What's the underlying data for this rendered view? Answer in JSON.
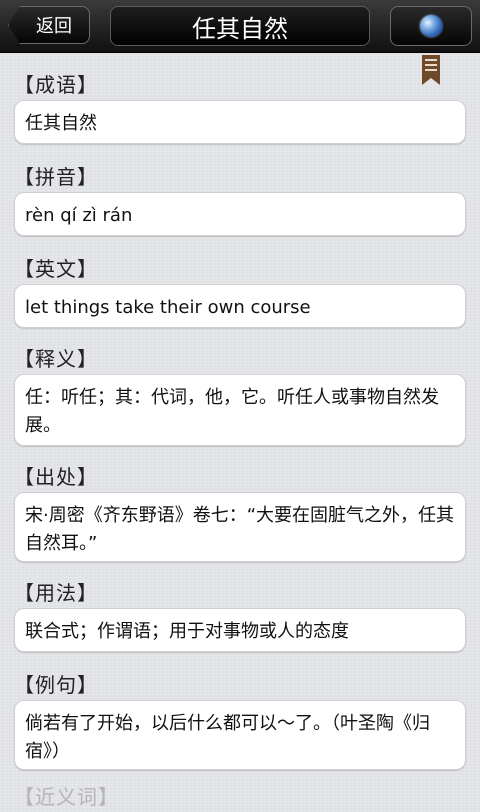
{
  "header": {
    "back_label": "返回",
    "title": "任其自然",
    "globe_icon": "globe-icon"
  },
  "bookmark_icon": "bookmark-icon",
  "sections": [
    {
      "label": "【成语】",
      "value": "任其自然"
    },
    {
      "label": "【拼音】",
      "value": "rèn qí zì rán"
    },
    {
      "label": "【英文】",
      "value": "let things take their own course"
    },
    {
      "label": "【释义】",
      "value": "任：听任；其：代词，他，它。听任人或事物自然发展。"
    },
    {
      "label": "【出处】",
      "value": "宋·周密《齐东野语》卷七：“大要在固脏气之外，任其自然耳。”"
    },
    {
      "label": "【用法】",
      "value": "联合式；作谓语；用于对事物或人的态度"
    },
    {
      "label": "【例句】",
      "value": "倘若有了开始，以后什么都可以～了。（叶圣陶《归宿》）"
    },
    {
      "label": "【近义词】",
      "value": ""
    }
  ]
}
